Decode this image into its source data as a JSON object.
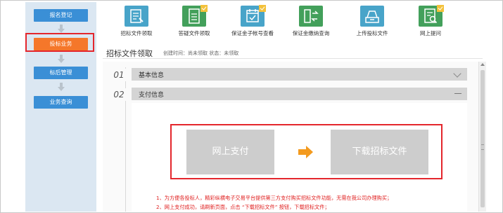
{
  "sidebar": {
    "items": [
      {
        "label": "报名登记"
      },
      {
        "label": "投标业务"
      },
      {
        "label": "标后管理"
      },
      {
        "label": "业务查询"
      }
    ],
    "active_index": 1
  },
  "toolbar": {
    "tools": [
      {
        "label": "招标文件领取",
        "icon": "tender-document-icon",
        "color": "#48a4c9",
        "checked": false
      },
      {
        "label": "答疑文件领取",
        "icon": "qa-document-icon",
        "color": "#43a05b",
        "checked": true
      },
      {
        "label": "保证金子帐号查看",
        "icon": "calendar-check-icon",
        "color": "#48a4c9",
        "checked": true
      },
      {
        "label": "保证金缴纳查询",
        "icon": "transfer-icon",
        "color": "#43a05b",
        "checked": false
      },
      {
        "label": "上传投标文件",
        "icon": "upload-tray-icon",
        "color": "#48a4c9",
        "checked": false
      },
      {
        "label": "网上提问",
        "icon": "search-document-icon",
        "color": "#43a05b",
        "checked": true
      }
    ]
  },
  "header": {
    "title": "招标文件领取",
    "subtitle": "创建时间：尚未领取  状态：未领取"
  },
  "sections": [
    {
      "number": "01",
      "title": "基本信息",
      "state": "collapsed"
    },
    {
      "number": "02",
      "title": "支付信息",
      "state": "expanded"
    }
  ],
  "payment": {
    "online_pay_label": "网上支付",
    "download_label": "下载招标文件"
  },
  "notes": [
    "1、为方便各投标人，精彩纵横电子交易平台提供第三方支付购买招标文件功能，无需在我公司办理购买；",
    "2、网上支付成功，请刷新页面，点击 “下载招标文件” 按钮，下载招标文件；"
  ],
  "colors": {
    "sidebar_bg": "#dbe7f2",
    "nav_button": "#3a8fd6",
    "active_nav": "#f5772a",
    "highlight": "#e4262c",
    "arrow": "#f39a1e"
  }
}
